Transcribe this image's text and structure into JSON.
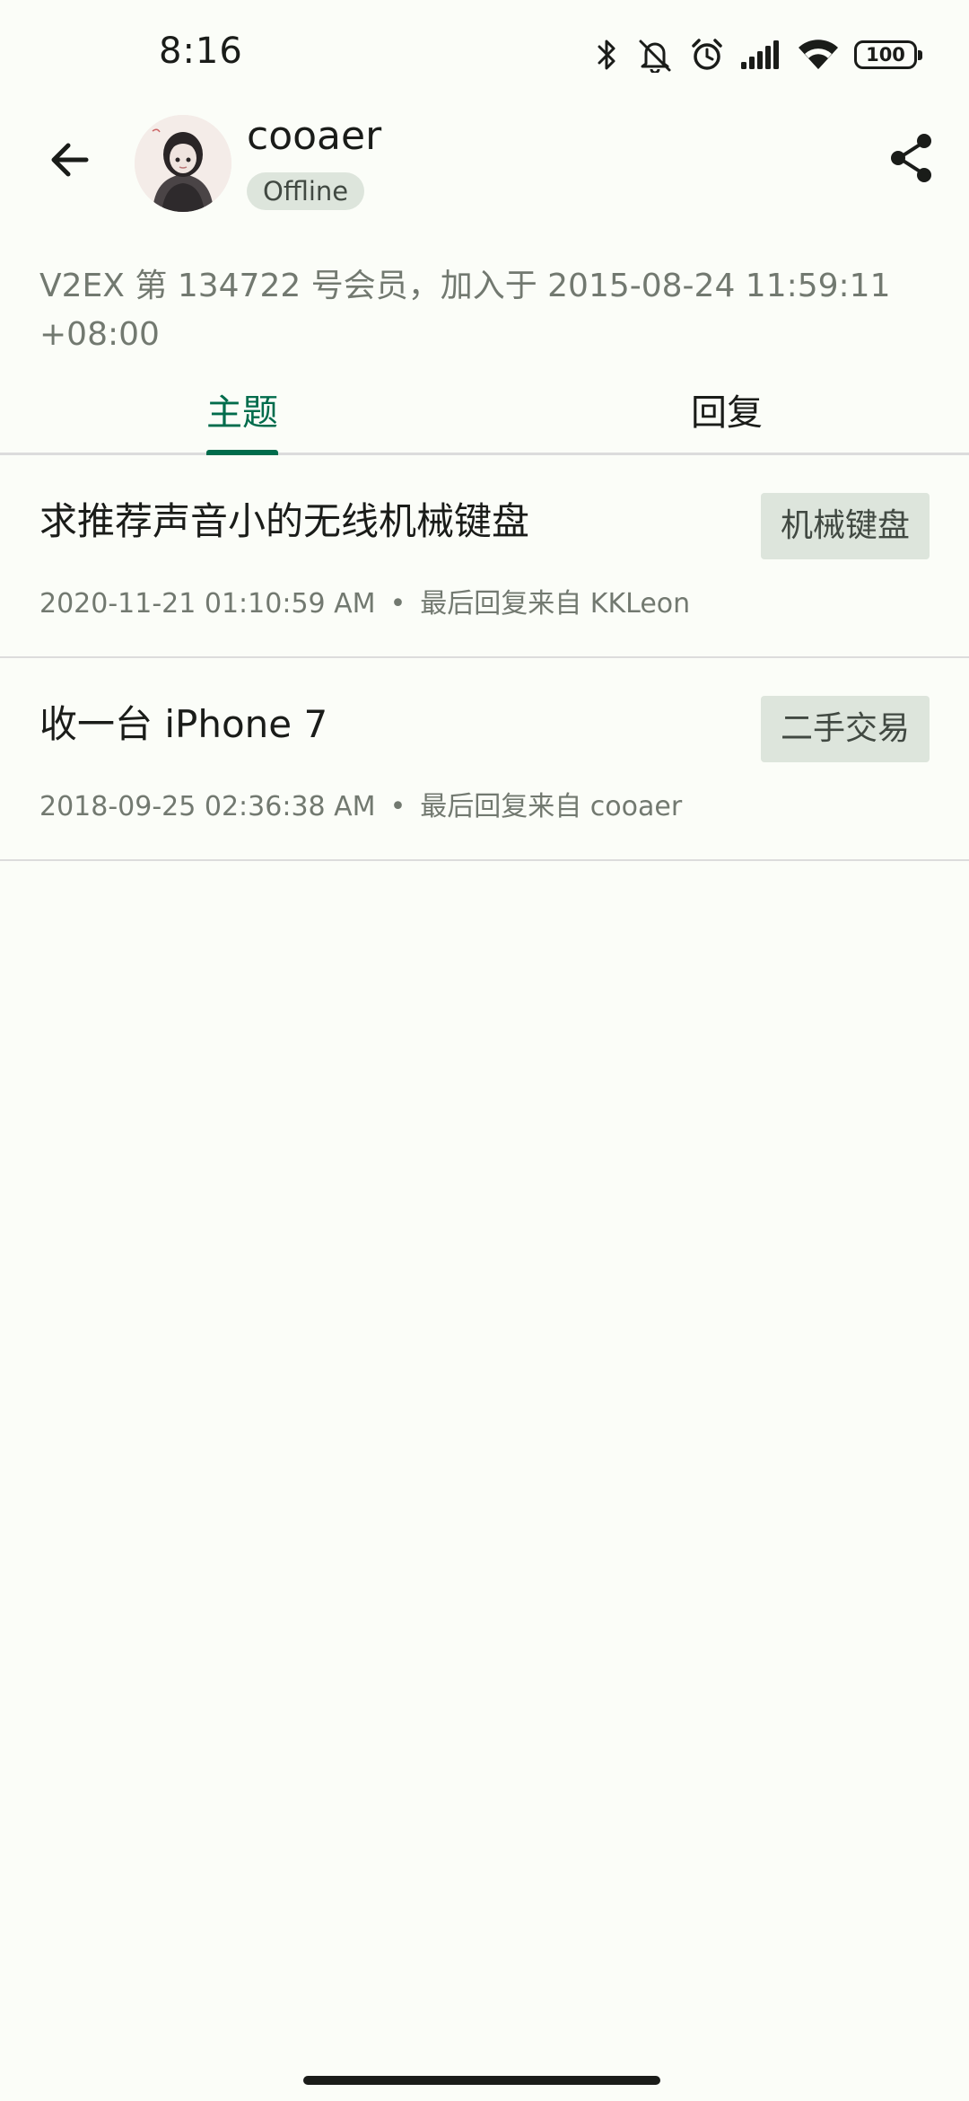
{
  "status_bar": {
    "time": "8:16",
    "battery": "100",
    "icons": [
      "bluetooth-icon",
      "muted-bell-icon",
      "alarm-icon",
      "signal-icon",
      "wifi-icon",
      "battery-icon"
    ]
  },
  "header": {
    "back_icon": "arrow-left-icon",
    "username": "cooaer",
    "status": "Offline",
    "share_icon": "share-icon"
  },
  "member_info": "V2EX 第 134722 号会员，加入于 2015-08-24 11:59:11 +08:00",
  "tabs": [
    {
      "label": "主题",
      "active": true
    },
    {
      "label": "回复",
      "active": false
    }
  ],
  "topics": [
    {
      "title": "求推荐声音小的无线机械键盘",
      "node": "机械键盘",
      "time": "2020-11-21 01:10:59 AM",
      "separator": "•",
      "last_reply": "最后回复来自 KKLeon"
    },
    {
      "title": "收一台 iPhone 7",
      "node": "二手交易",
      "time": "2018-09-25 02:36:38 AM",
      "separator": "•",
      "last_reply": "最后回复来自 cooaer"
    }
  ],
  "colors": {
    "background": "#fbfdf8",
    "accent": "#006c4c",
    "chip": "#dde5dc",
    "secondary_text": "#727970"
  }
}
